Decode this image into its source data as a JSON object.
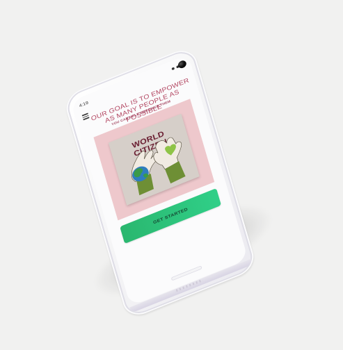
{
  "status": {
    "time": "4:19"
  },
  "header": {
    "menu_icon": "hamburger-menu-icon",
    "headline": "OUR GOAL IS TO EMPOWER AS MANY PEOPLE AS POSSIBLE",
    "subline": "YOU CAN HELP EMPOWER THEM"
  },
  "hero": {
    "title": "WORLD CITIZEN",
    "background_color": "#eec8cc",
    "art_color": "#d6cfc9"
  },
  "cta": {
    "label": "GET STARTED",
    "color": "#2ab76f"
  }
}
